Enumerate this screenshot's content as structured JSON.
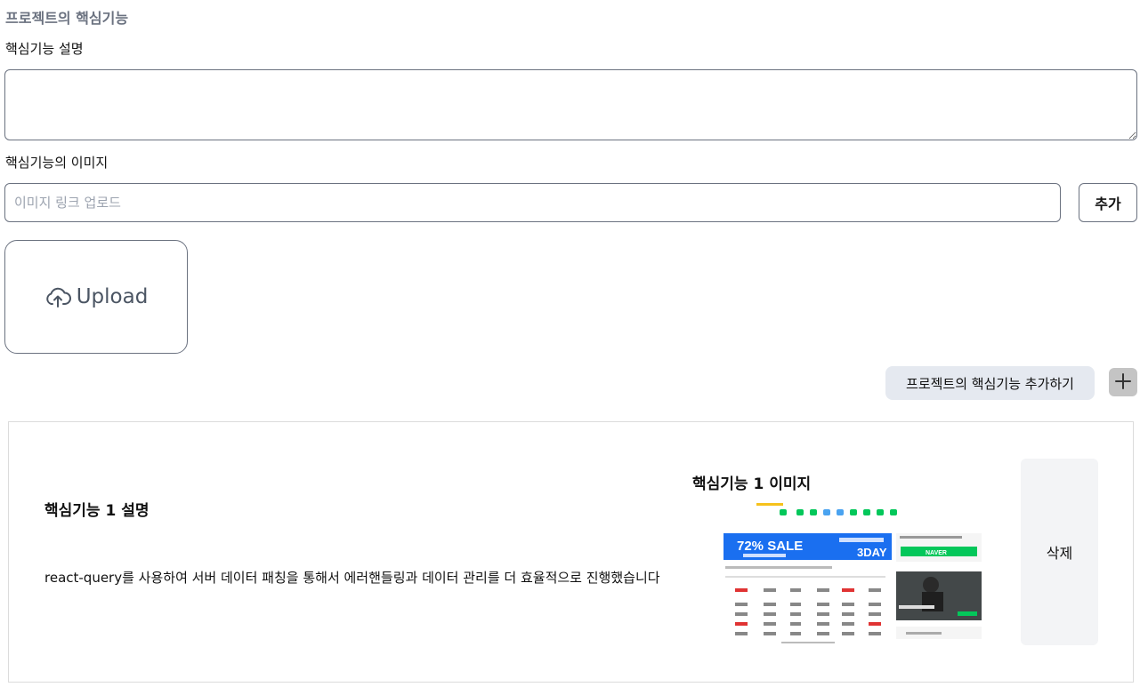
{
  "section": {
    "title": "프로젝트의 핵심기능"
  },
  "form": {
    "description_label": "핵심기능 설명",
    "description_value": "",
    "image_label": "핵심기능의 이미지",
    "image_link_placeholder": "이미지 링크 업로드",
    "image_link_value": "",
    "add_button_label": "추가",
    "upload_label": "Upload",
    "upload_icon": "cloud-upload-icon"
  },
  "add_feature": {
    "label": "프로젝트의 핵심기능 추가하기",
    "icon": "plus-icon"
  },
  "features": [
    {
      "title": "핵심기능 1 설명",
      "description": "react-query를 사용하여 서버 데이터 패칭을 통해서 에러핸들링과 데이터 관리를 더 효율적으로 진행했습니다",
      "image_title": "핵심기능 1 이미지",
      "thumbnail": {
        "banner_text": "72% SALE",
        "banner_right_text": "3DAY",
        "login_button_text": "NAVER",
        "accent_color": "#1a73e8",
        "naver_green": "#03c75a"
      },
      "delete_label": "삭제"
    }
  ]
}
